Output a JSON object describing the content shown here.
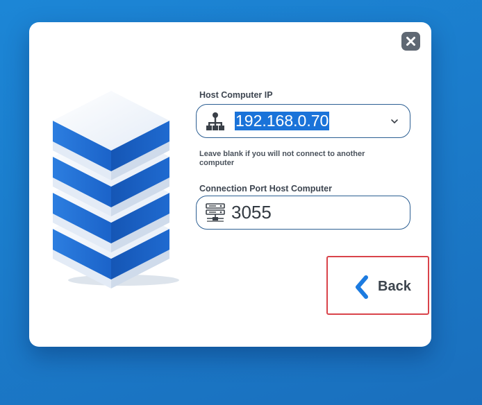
{
  "dialog": {
    "close_icon": "close-icon",
    "illustration": "server-stack-illustration"
  },
  "host_ip": {
    "label": "Host Computer IP",
    "value": "192.168.0.70",
    "icon": "network-icon",
    "hint": "Leave blank if you will not connect to another computer",
    "dropdown_icon": "chevron-down-icon"
  },
  "port": {
    "label": "Connection Port Host Computer",
    "value": "3055",
    "icon": "server-icon"
  },
  "back_button": {
    "label": "Back",
    "icon": "chevron-left-icon"
  },
  "colors": {
    "background": "#1b7ccb",
    "accent": "#1a73d9",
    "back_border": "#d9434a",
    "field_border": "#2b5e92"
  }
}
